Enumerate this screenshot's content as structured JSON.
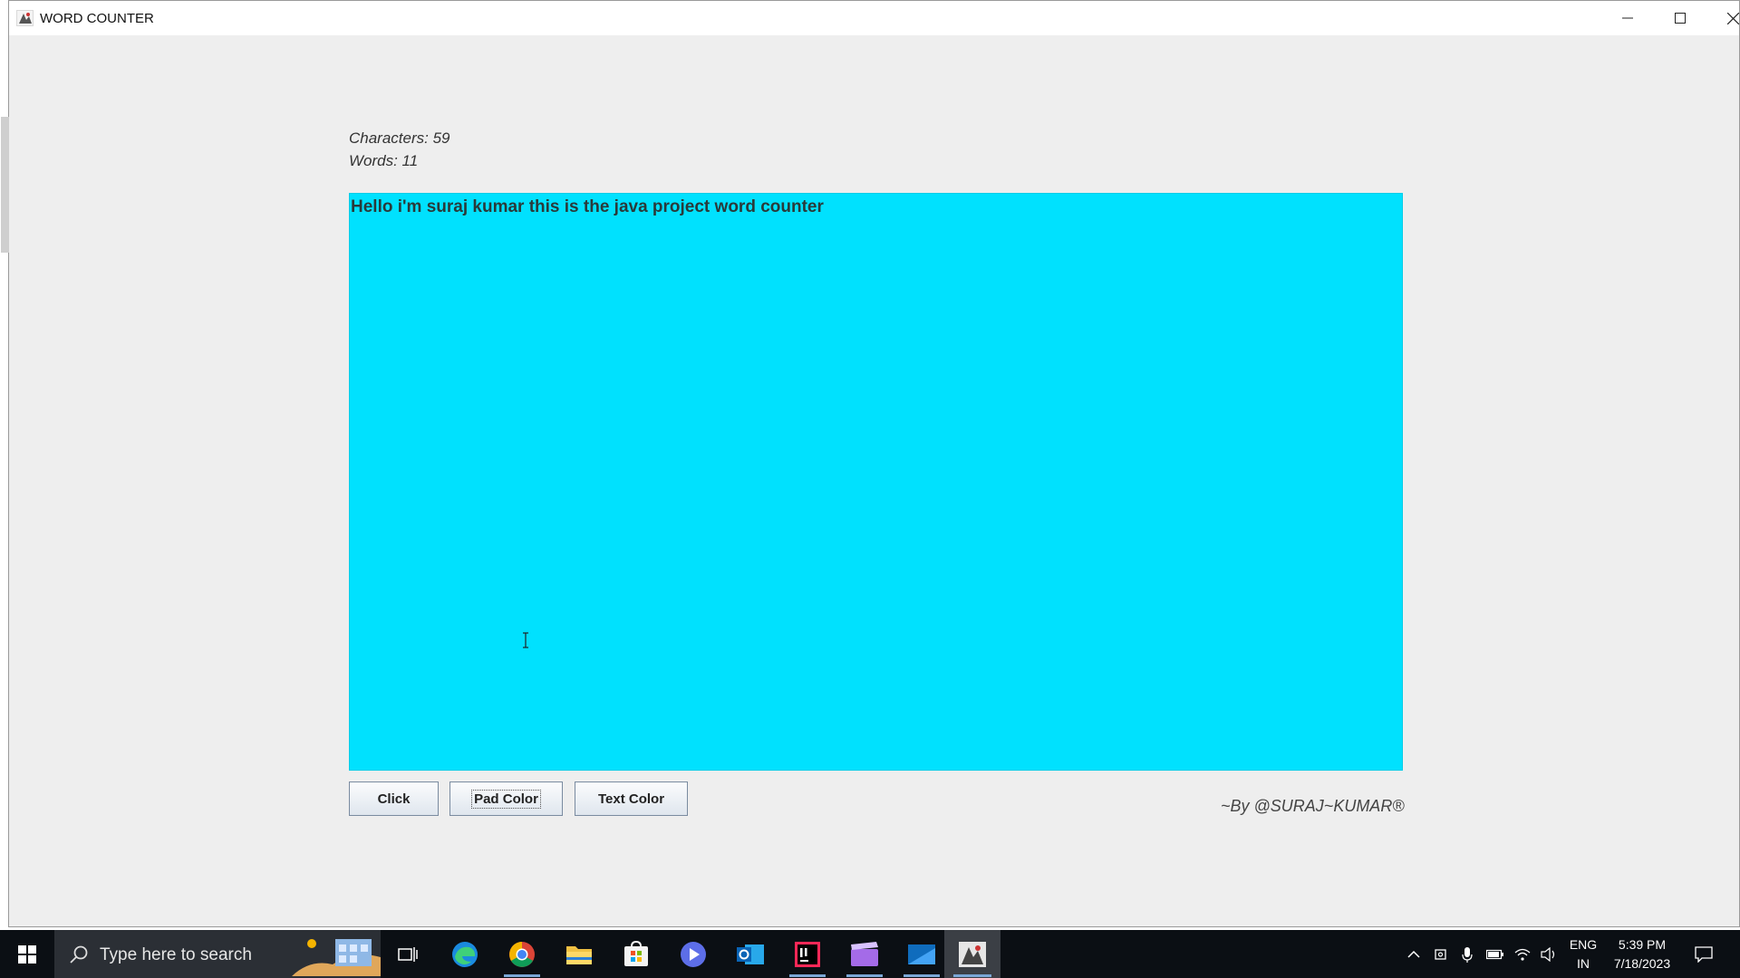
{
  "window": {
    "title": "WORD COUNTER",
    "controls": {
      "minimize": "minimize-icon",
      "maximize": "maximize-icon",
      "close": "close-icon"
    }
  },
  "stats": {
    "characters": "Characters: 59",
    "words": "Words: 11"
  },
  "textpad": {
    "text": "Hello i'm suraj kumar this is the java project word counter",
    "background_color": "#00e1fe"
  },
  "buttons": {
    "click": "Click",
    "pad_color": "Pad Color",
    "text_color": "Text Color"
  },
  "byline": "~By @SURAJ~KUMAR®",
  "taskbar": {
    "search_placeholder": "Type here to search",
    "apps": [
      "task-view",
      "edge",
      "chrome",
      "file-explorer",
      "microsoft-store",
      "video-app",
      "outlook",
      "intellij-idea",
      "clipchamp",
      "mail",
      "java-app"
    ],
    "tray": {
      "language_line1": "ENG",
      "language_line2": "IN",
      "time": "5:39 PM",
      "date": "7/18/2023"
    }
  }
}
